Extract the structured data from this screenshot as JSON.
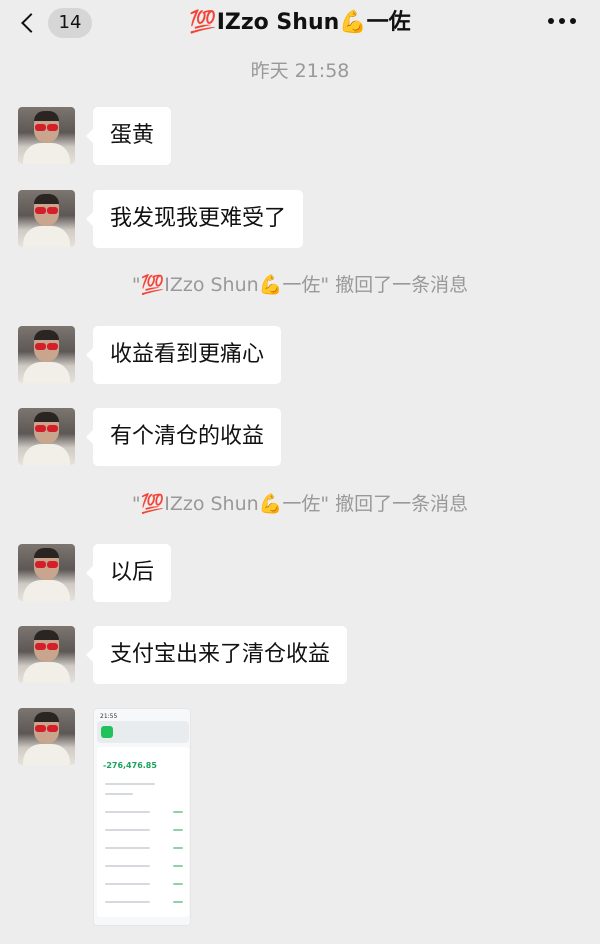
{
  "header": {
    "back_badge": "14",
    "title_emoji": "💯",
    "title_name": "IZzo Shun",
    "title_arm": "💪",
    "title_suffix": "一佐"
  },
  "timestamp": "昨天 21:58",
  "messages": [
    {
      "type": "text",
      "text": "蛋黄"
    },
    {
      "type": "text",
      "text": "我发现我更难受了"
    },
    {
      "type": "recall",
      "quote_open": "\"",
      "emoji": "💯",
      "name": "IZzo Shun",
      "arm": "💪",
      "suffix": "一佐",
      "quote_close": "\"",
      "notice": " 撤回了一条消息"
    },
    {
      "type": "text",
      "text": "收益看到更痛心"
    },
    {
      "type": "text",
      "text": "有个清仓的收益"
    },
    {
      "type": "recall",
      "quote_open": "\"",
      "emoji": "💯",
      "name": "IZzo Shun",
      "arm": "💪",
      "suffix": "一佐",
      "quote_close": "\"",
      "notice": " 撤回了一条消息"
    },
    {
      "type": "text",
      "text": "以后"
    },
    {
      "type": "text",
      "text": "支付宝出来了清仓收益"
    },
    {
      "type": "image",
      "status_time": "21:55",
      "amount": "-276,476.85"
    }
  ],
  "colors": {
    "background": "#ededed",
    "bubble": "#ffffff",
    "system_text": "#999999"
  },
  "icons": {
    "back": "chevron-left-icon",
    "more": "more-dots-icon"
  }
}
